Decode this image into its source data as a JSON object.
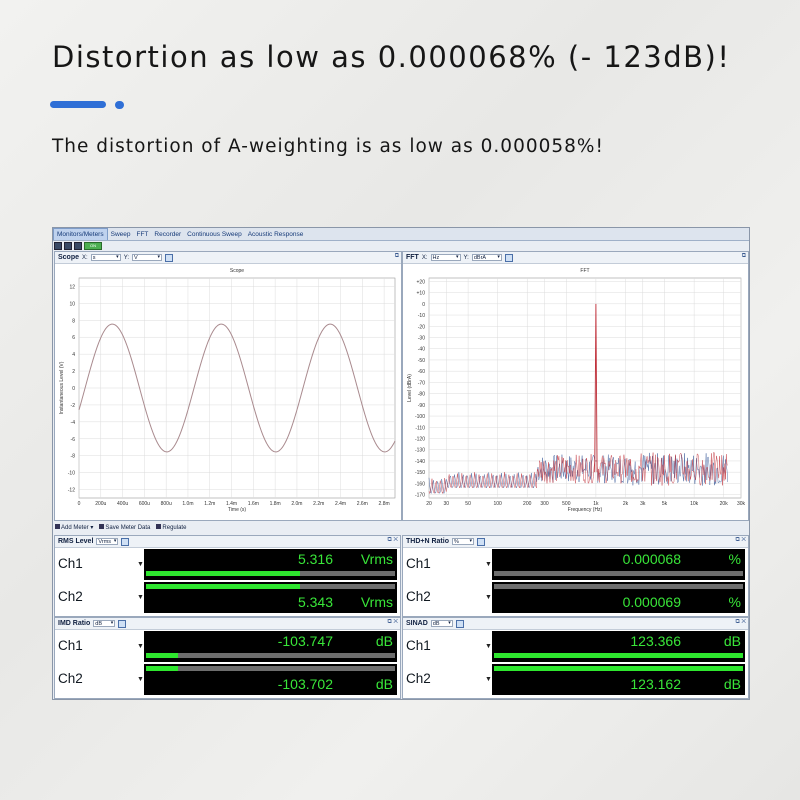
{
  "headline": "Distortion as low as 0.000068% (- 123dB)!",
  "subline": "The distortion of A-weighting is as low as 0.000058%!",
  "colors": {
    "accent": "#2f6fd6",
    "meter_green": "#39e639",
    "trace_red": "#c0303a",
    "trace_blue": "#3a5a9a"
  },
  "tabs": [
    "Monitors/Meters",
    "Sweep",
    "FFT",
    "Recorder",
    "Continuous Sweep",
    "Acoustic Response"
  ],
  "scope": {
    "title": "Scope",
    "x_label": "X:",
    "x_unit": "s",
    "y_label": "Y:",
    "y_unit": "V",
    "chart_title": "Scope",
    "xlabel": "Time (s)",
    "ylabel": "Instantaneous Level (V)",
    "y_ticks": [
      "12",
      "10",
      "8",
      "6",
      "4",
      "2",
      "0",
      "-2",
      "-4",
      "-6",
      "-8",
      "-10",
      "-12"
    ],
    "x_ticks": [
      "0",
      "200u",
      "400u",
      "600u",
      "800u",
      "1.0m",
      "1.2m",
      "1.4m",
      "1.6m",
      "1.8m",
      "2.0m",
      "2.2m",
      "2.4m",
      "2.6m",
      "2.8m"
    ]
  },
  "fft": {
    "title": "FFT",
    "x_label": "X:",
    "x_unit": "Hz",
    "y_label": "Y:",
    "y_unit": "dBrA",
    "chart_title": "FFT",
    "xlabel": "Frequency (Hz)",
    "ylabel": "Level (dBrA)",
    "y_ticks": [
      "+20",
      "+10",
      "0",
      "-10",
      "-20",
      "-30",
      "-40",
      "-50",
      "-60",
      "-70",
      "-80",
      "-90",
      "-100",
      "-110",
      "-120",
      "-130",
      "-140",
      "-150",
      "-160",
      "-170"
    ],
    "x_ticks": [
      "20",
      "30",
      "50",
      "100",
      "200",
      "300",
      "500",
      "1k",
      "2k",
      "3k",
      "5k",
      "10k",
      "20k",
      "30k"
    ]
  },
  "chart_data": [
    {
      "type": "line",
      "title": "Scope",
      "xlabel": "Time (s)",
      "ylabel": "Instantaneous Level (V)",
      "xlim": [
        0,
        0.0029
      ],
      "ylim": [
        -13,
        13
      ],
      "grid": true,
      "series": [
        {
          "values_desc": "sine",
          "amplitude": 7.55,
          "frequency": 1000
        }
      ]
    },
    {
      "type": "line",
      "title": "FFT",
      "xlabel": "Frequency (Hz)",
      "ylabel": "Level (dBrA)",
      "xlim": [
        20,
        30000
      ],
      "ylim": [
        -173,
        23
      ],
      "xscale": "log",
      "grid": true,
      "peaks": [
        {
          "x": 1000,
          "y": 0
        }
      ]
    }
  ],
  "addbar": {
    "add_meter": "Add Meter",
    "save": "Save Meter Data",
    "regulate": "Regulate"
  },
  "meters": [
    {
      "title": "RMS Level",
      "unit_select": "Vrms",
      "ch1": {
        "label": "Ch1",
        "value": "5.316",
        "unit": "Vrms",
        "fill": 0.62
      },
      "ch2": {
        "label": "Ch2",
        "value": "5.343",
        "unit": "Vrms",
        "fill": 0.62
      }
    },
    {
      "title": "THD+N Ratio",
      "unit_select": "%",
      "ch1": {
        "label": "Ch1",
        "value": "0.000068",
        "unit": "%",
        "fill": 0
      },
      "ch2": {
        "label": "Ch2",
        "value": "0.000069",
        "unit": "%",
        "fill": 0
      }
    },
    {
      "title": "IMD Ratio",
      "unit_select": "dB",
      "ch1": {
        "label": "Ch1",
        "value": "-103.747",
        "unit": "dB",
        "fill": 0.13
      },
      "ch2": {
        "label": "Ch2",
        "value": "-103.702",
        "unit": "dB",
        "fill": 0.13
      }
    },
    {
      "title": "SINAD",
      "unit_select": "dB",
      "ch1": {
        "label": "Ch1",
        "value": "123.366",
        "unit": "dB",
        "fill": 1.0
      },
      "ch2": {
        "label": "Ch2",
        "value": "123.162",
        "unit": "dB",
        "fill": 1.0
      }
    }
  ]
}
